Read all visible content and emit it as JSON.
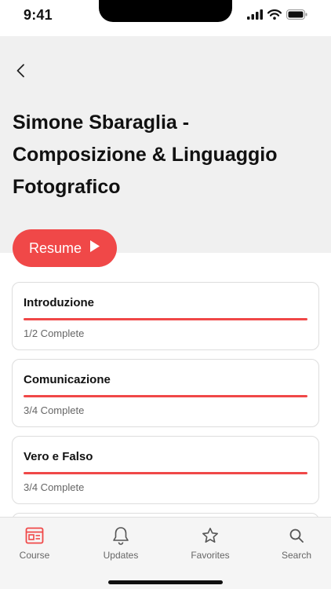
{
  "status_bar": {
    "time": "9:41"
  },
  "header": {
    "title": "Simone Sbaraglia - Composizione & Linguaggio Fotografico"
  },
  "resume_button": {
    "label": "Resume"
  },
  "sections": [
    {
      "title": "Introduzione",
      "status": "1/2 Complete",
      "progress": 1.0
    },
    {
      "title": "Comunicazione",
      "status": "3/4 Complete",
      "progress": 1.0
    },
    {
      "title": "Vero e Falso",
      "status": "3/4 Complete",
      "progress": 1.0
    }
  ],
  "tab_bar": {
    "tabs": [
      {
        "label": "Course",
        "icon": "course-icon",
        "active": true
      },
      {
        "label": "Updates",
        "icon": "bell-icon",
        "active": false
      },
      {
        "label": "Favorites",
        "icon": "star-icon",
        "active": false
      },
      {
        "label": "Search",
        "icon": "search-icon",
        "active": false
      }
    ]
  },
  "colors": {
    "accent": "#f04848",
    "header_bg": "#f0f0f0",
    "tab_bar_bg": "#f5f5f5"
  }
}
